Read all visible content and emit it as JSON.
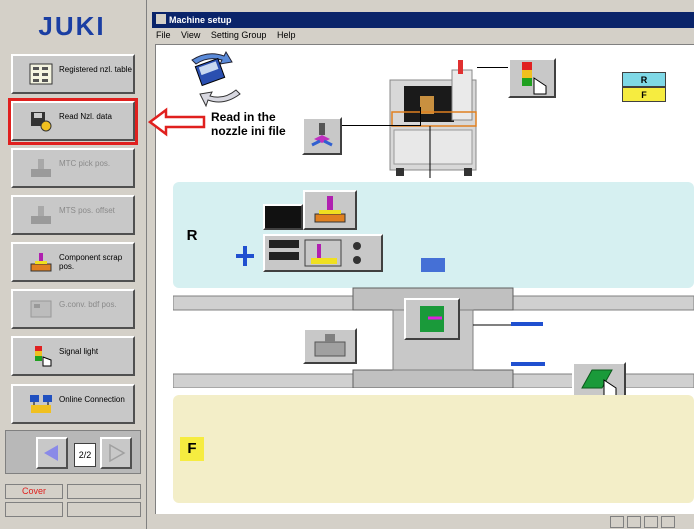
{
  "logo": "JUKI",
  "window": {
    "title": "Machine setup"
  },
  "menu": [
    "File",
    "View",
    "Setting Group",
    "Help"
  ],
  "sidebar": {
    "buttons": [
      {
        "label": "Registered nzl. table",
        "enabled": true
      },
      {
        "label": "Read Nzl. data",
        "enabled": true,
        "highlighted": true
      },
      {
        "label": "MTC pick pos.",
        "enabled": false
      },
      {
        "label": "MTS pos. offset",
        "enabled": false
      },
      {
        "label": "Component scrap pos.",
        "enabled": true
      },
      {
        "label": "G.conv. bdf pos.",
        "enabled": false
      },
      {
        "label": "Signal light",
        "enabled": true
      },
      {
        "label": "Online Connection",
        "enabled": true
      }
    ],
    "page_indicator": "2/2",
    "status": [
      "Cover",
      "",
      "",
      ""
    ]
  },
  "annotation": {
    "text": "Read in the nozzle ini file"
  },
  "legend": {
    "r": "R",
    "f": "F"
  },
  "panels": {
    "r_label": "R",
    "f_label": "F"
  },
  "colors": {
    "highlight": "#e0201e",
    "title_bar": "#0a246a",
    "r_panel": "#d6f0f1",
    "f_panel": "#f3eec8",
    "logo": "#1a3ea3"
  }
}
